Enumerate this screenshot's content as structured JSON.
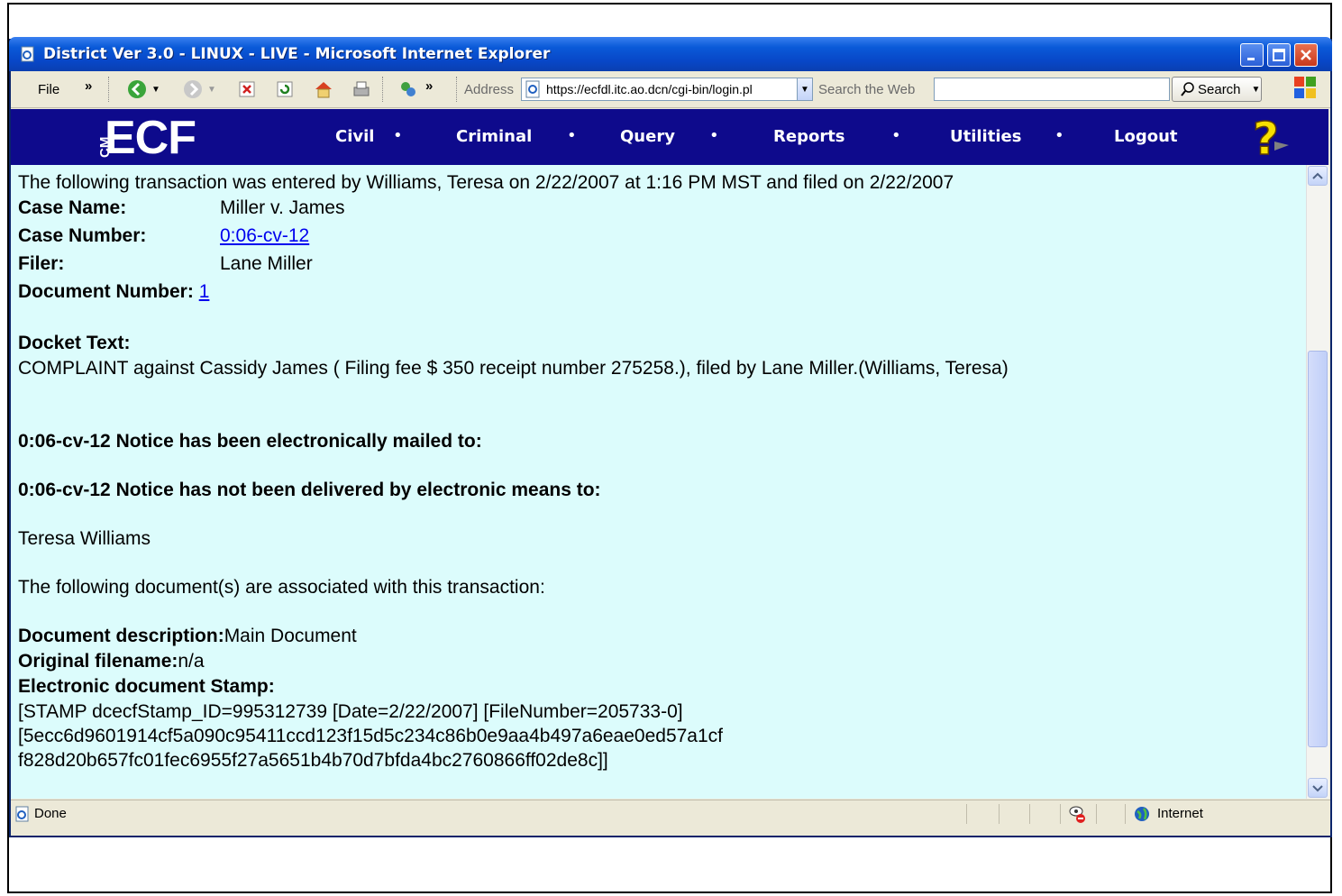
{
  "window": {
    "title": "District Ver 3.0 - LINUX - LIVE - Microsoft Internet Explorer"
  },
  "toolbar": {
    "file_label": "File",
    "chevron": "»",
    "address_label": "Address",
    "address_value": "https://ecfdl.itc.ao.dcn/cgi-bin/login.pl",
    "search_label": "Search the Web",
    "search_button": "Search"
  },
  "ecf": {
    "logo": "ECF",
    "logo_prefix": "CM",
    "nav": [
      "Civil",
      "Criminal",
      "Query",
      "Reports",
      "Utilities",
      "Logout"
    ],
    "dot": "•"
  },
  "content": {
    "intro": "The following transaction was entered by Williams, Teresa on 2/22/2007 at 1:16 PM MST and filed on 2/22/2007",
    "case_name_label": "Case Name:",
    "case_name": "Miller v. James",
    "case_number_label": "Case Number:",
    "case_number": "0:06-cv-12",
    "filer_label": "Filer:",
    "filer": "Lane Miller",
    "document_number_label": "Document Number:",
    "document_number": "1",
    "docket_text_label": "Docket Text:",
    "docket_text": "COMPLAINT against Cassidy James ( Filing fee $ 350 receipt number 275258.), filed by Lane Miller.(Williams, Teresa)",
    "notice_mailed": "0:06-cv-12 Notice has been electronically mailed to:",
    "notice_not_delivered": "0:06-cv-12 Notice has not been delivered by electronic means to:",
    "recipient": "Teresa Williams",
    "associated_docs": "The following document(s) are associated with this transaction:",
    "doc_description_label": "Document description:",
    "doc_description": "Main Document",
    "original_filename_label": "Original filename:",
    "original_filename": "n/a",
    "stamp_label": "Electronic document Stamp:",
    "stamp_line1": "[STAMP dcecfStamp_ID=995312739 [Date=2/22/2007] [FileNumber=205733-0]",
    "stamp_line2": "[5ecc6d9601914cf5a090c95411ccd123f15d5c234c86b0e9aa4b497a6eae0ed57a1cf",
    "stamp_line3": "f828d20b657fc01fec6955f27a5651b4b70d7bfda4bc2760866ff02de8c]]"
  },
  "status": {
    "left": "Done",
    "zone": "Internet"
  }
}
